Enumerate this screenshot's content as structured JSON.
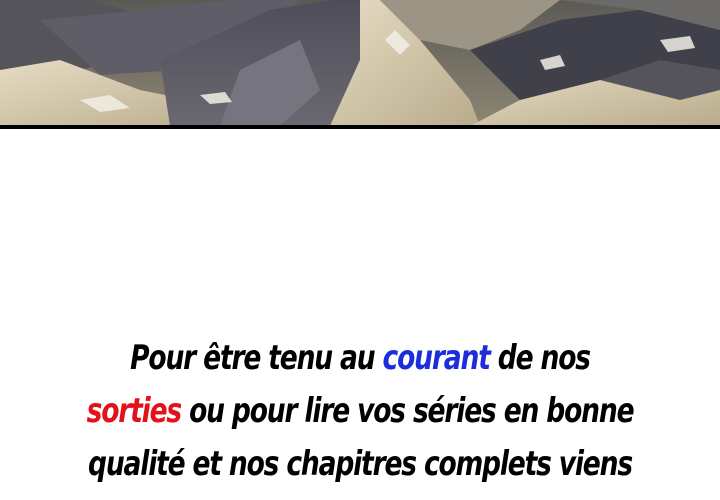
{
  "panel": {
    "description_icon": "mountain-landscape-illustration"
  },
  "promo": {
    "line1_a": "Pour être tenu au",
    "line1_highlight": "courant",
    "line1_b": "de nos",
    "line2_highlight": "sorties",
    "line2_b": "ou pour lire vos séries en bonne",
    "line3": "qualité et nos chapitres complets viens"
  },
  "colors": {
    "highlight_blue": "#1e2ddc",
    "highlight_red": "#e3111a",
    "text": "#000000"
  }
}
